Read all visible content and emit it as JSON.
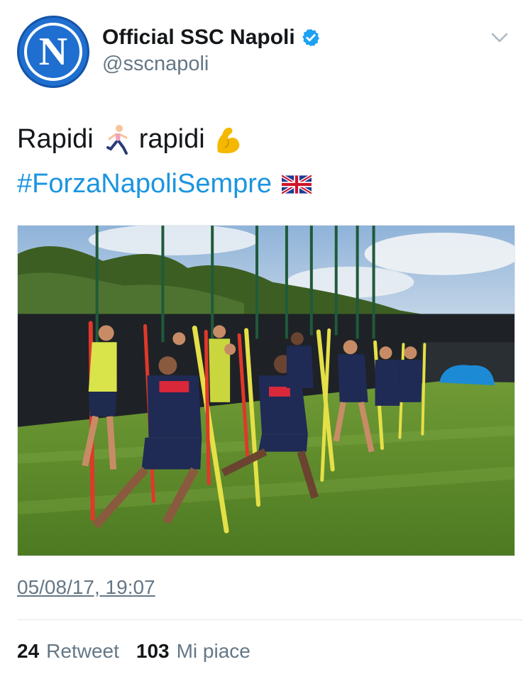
{
  "author": {
    "display_name": "Official SSC Napoli",
    "handle": "@sscnapoli",
    "avatar_letter": "N",
    "verified": true
  },
  "tweet": {
    "line1_word1": "Rapidi",
    "line1_word2": "rapidi",
    "emoji1": "running-man-emoji",
    "emoji2": "flexed-biceps-emoji",
    "hashtag": "#ForzaNapoliSempre",
    "flag": "uk-flag-emoji",
    "photo_description_icon": "training-photo"
  },
  "meta": {
    "timestamp": "05/08/17, 19:07"
  },
  "stats": {
    "retweets_count": "24",
    "retweets_label": "Retweet",
    "likes_count": "103",
    "likes_label": "Mi piace"
  },
  "colors": {
    "link": "#1b95e0",
    "muted": "#657786",
    "text": "#14171a",
    "verified": "#1da1f2"
  }
}
